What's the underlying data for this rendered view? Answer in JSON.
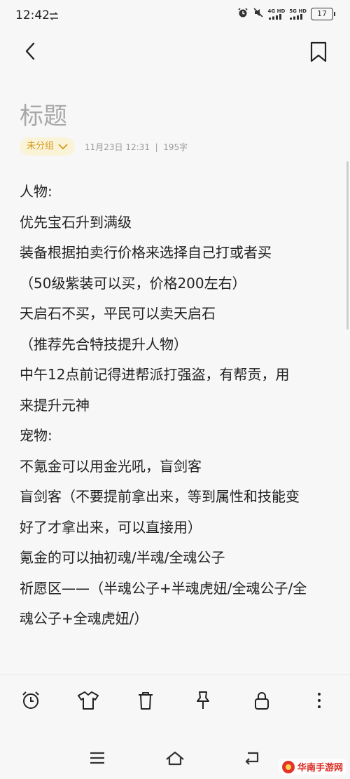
{
  "status_bar": {
    "time": "12:42",
    "network1": "4G HD",
    "network2": "5G HD",
    "battery": "17"
  },
  "note": {
    "title": "标题",
    "group_label": "未分组",
    "meta": "11月23日 12:31  |  195字",
    "lines": [
      "人物:",
      "优先宝石升到满级",
      "装备根据拍卖行价格来选择自己打或者买",
      "（50级紫装可以买，价格200左右）",
      "天启石不买，平民可以卖天启石",
      "（推荐先合特技提升人物）",
      "中午12点前记得进帮派打强盗，有帮贡，用",
      "来提升元神",
      "宠物:",
      "不氪金可以用金光吼，盲剑客",
      "盲剑客（不要提前拿出来，等到属性和技能变",
      "好了才拿出来，可以直接用）",
      "氪金的可以抽初魂/半魂/全魂公子",
      "祈愿区——（半魂公子+半魂虎妞/全魂公子/全",
      "魂公子+全魂虎妞/）"
    ]
  },
  "toolbar": {
    "icons": [
      "alarm-icon",
      "shirt-icon",
      "trash-icon",
      "pin-icon",
      "lock-icon",
      "more-icon"
    ]
  },
  "watermark": {
    "text": "华南手游网"
  },
  "colors": {
    "background": "#f7f7f7",
    "accent": "#d39a16",
    "chip_bg": "#fbf3d8"
  }
}
